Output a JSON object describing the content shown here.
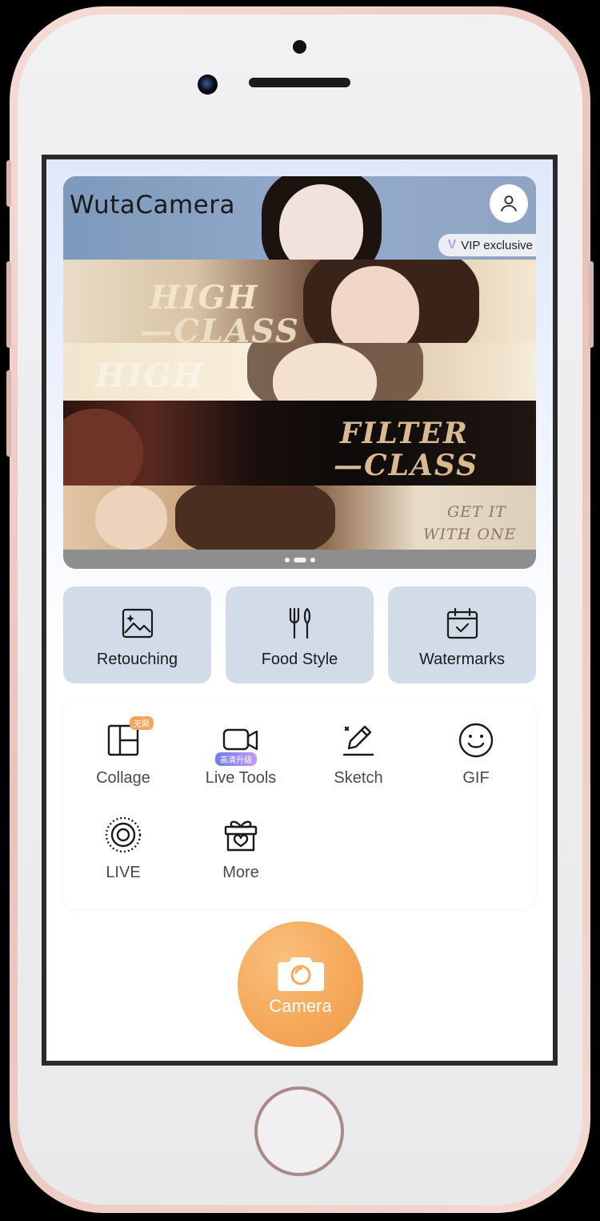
{
  "app": {
    "title": "WutaCamera"
  },
  "banner": {
    "vip_label": "VIP exclusive",
    "vip_mark": "V",
    "promo_lines": [
      "HIGH",
      "—CLASS",
      "HIGH",
      "FILTER",
      "—CLASS",
      "GET IT",
      "WITH ONE"
    ],
    "pager": {
      "count": 3,
      "active": 1
    }
  },
  "features": [
    {
      "label": "Retouching",
      "icon": "image-sparkle-icon"
    },
    {
      "label": "Food Style",
      "icon": "fork-knife-icon"
    },
    {
      "label": "Watermarks",
      "icon": "calendar-check-icon"
    }
  ],
  "tools": [
    {
      "label": "Collage",
      "icon": "collage-icon",
      "badge": "无限"
    },
    {
      "label": "Live Tools",
      "icon": "video-camera-icon",
      "badge": "高清升级"
    },
    {
      "label": "Sketch",
      "icon": "pencil-icon"
    },
    {
      "label": "GIF",
      "icon": "smiley-icon"
    },
    {
      "label": "LIVE",
      "icon": "live-target-icon"
    },
    {
      "label": "More",
      "icon": "gift-icon"
    }
  ],
  "camera": {
    "label": "Camera",
    "icon": "camera-icon"
  },
  "colors": {
    "accent": "#f5a95a",
    "card_bg": "#d2dbe8",
    "badge": "#f6a35b"
  }
}
